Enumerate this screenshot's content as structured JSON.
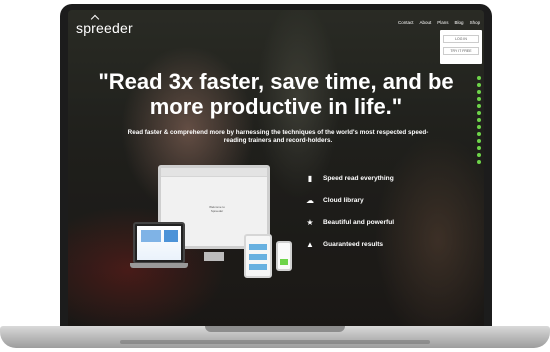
{
  "brand": {
    "logo": "spreeder"
  },
  "nav": {
    "items": [
      "Contact",
      "About",
      "Plans",
      "Blog",
      "Shop"
    ]
  },
  "login": {
    "primary": "LOG IN",
    "secondary": "TRY IT FREE"
  },
  "hero": {
    "headline": "\"Read 3x faster, save time, and be more productive in life.\"",
    "subline": "Read faster & comprehend more by harnessing the techniques of the world's most respected speed-reading trainers and record-holders."
  },
  "features": [
    {
      "icon": "book-icon",
      "label": "Speed read everything"
    },
    {
      "icon": "cloud-icon",
      "label": "Cloud library"
    },
    {
      "icon": "star-icon",
      "label": "Beautiful and powerful"
    },
    {
      "icon": "thumbs-up-icon",
      "label": "Guaranteed results"
    }
  ],
  "mockup": {
    "monitor_text": "Welcome to Spreeder"
  },
  "colors": {
    "accent": "#6ed44a",
    "frame": "#1c1c1c"
  }
}
